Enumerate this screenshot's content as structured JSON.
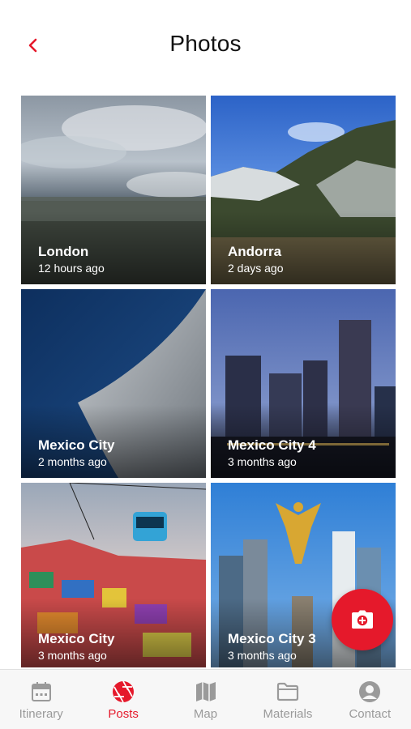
{
  "header": {
    "title": "Photos"
  },
  "photos": [
    {
      "name": "London",
      "time": "12 hours ago"
    },
    {
      "name": "Andorra",
      "time": "2 days ago"
    },
    {
      "name": "Mexico City",
      "time": "2 months ago"
    },
    {
      "name": "Mexico City 4",
      "time": "3 months ago"
    },
    {
      "name": "Mexico City",
      "time": "3 months ago"
    },
    {
      "name": "Mexico City 3",
      "time": "3 months ago"
    }
  ],
  "tabs": [
    {
      "label": "Itinerary",
      "icon": "calendar-icon"
    },
    {
      "label": "Posts",
      "icon": "camera-shutter-icon",
      "active": true
    },
    {
      "label": "Map",
      "icon": "map-icon"
    },
    {
      "label": "Materials",
      "icon": "folder-icon"
    },
    {
      "label": "Contact",
      "icon": "user-circle-icon"
    }
  ],
  "fab": {
    "icon": "add-photo-camera-icon"
  },
  "colors": {
    "accent": "#e5192b",
    "inactive": "#9a9a9a",
    "tabbar_bg": "#f7f7f7"
  }
}
